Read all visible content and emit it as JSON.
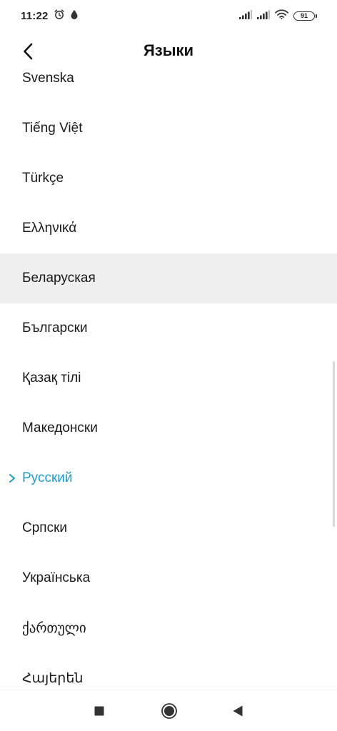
{
  "status_bar": {
    "time": "11:22",
    "battery_level": "91",
    "icons": [
      "alarm-icon",
      "drop-icon",
      "signal-icon",
      "signal-icon",
      "wifi-icon",
      "battery-icon"
    ]
  },
  "header": {
    "title": "Языки",
    "back_icon": "chevron-left-icon"
  },
  "languages": [
    {
      "label": "Svenska",
      "highlighted": false,
      "selected": false
    },
    {
      "label": "Tiếng Việt",
      "highlighted": false,
      "selected": false
    },
    {
      "label": "Türkçe",
      "highlighted": false,
      "selected": false
    },
    {
      "label": "Ελληνικά",
      "highlighted": false,
      "selected": false
    },
    {
      "label": "Беларуская",
      "highlighted": true,
      "selected": false
    },
    {
      "label": "Български",
      "highlighted": false,
      "selected": false
    },
    {
      "label": "Қазақ тілі",
      "highlighted": false,
      "selected": false
    },
    {
      "label": "Македонски",
      "highlighted": false,
      "selected": false
    },
    {
      "label": "Русский",
      "highlighted": false,
      "selected": true
    },
    {
      "label": "Српски",
      "highlighted": false,
      "selected": false
    },
    {
      "label": "Українська",
      "highlighted": false,
      "selected": false
    },
    {
      "label": "ქართული",
      "highlighted": false,
      "selected": false
    },
    {
      "label": "Հայերեն",
      "highlighted": false,
      "selected": false
    }
  ],
  "colors": {
    "accent": "#1b9ccf",
    "highlight_bg": "#efefef",
    "text": "#1a1a1a"
  },
  "nav_bar": {
    "icons": [
      "square-recents-icon",
      "circle-home-icon",
      "triangle-back-icon"
    ]
  }
}
